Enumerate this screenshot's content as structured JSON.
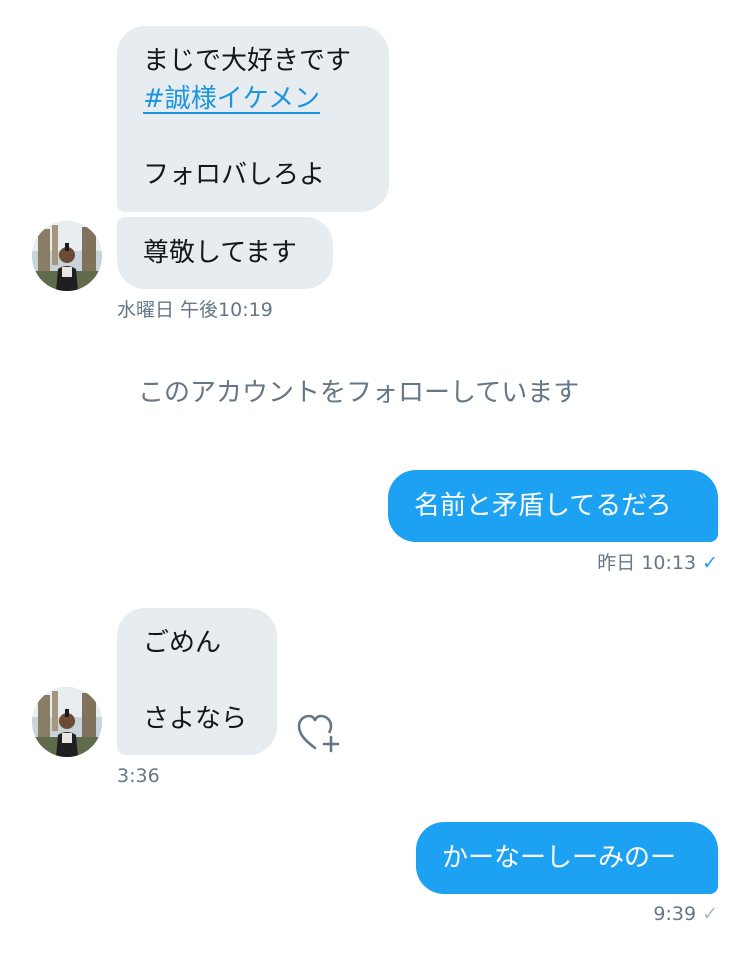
{
  "conversation": {
    "group1": {
      "bubble1": {
        "line1": "まじで大好きです",
        "hashtag": "#誠様イケメン",
        "line3": "フォロバしろよ"
      },
      "bubble2": "尊敬してます",
      "timestamp": "水曜日 午後10:19"
    },
    "system_notice": "このアカウントをフォローしています",
    "sent1": {
      "text": "名前と矛盾してるだろ",
      "timestamp": "昨日 10:13",
      "status_icon": "check-icon",
      "status_color": "#1da1f2"
    },
    "group2": {
      "line1": "ごめん",
      "line2": "さよなら",
      "timestamp": "3:36",
      "reaction_icon": "heart-plus-icon"
    },
    "sent2": {
      "text": "かーなーしーみのー",
      "timestamp": "9:39",
      "status_icon": "check-icon",
      "status_color": "#aab8c2"
    }
  },
  "colors": {
    "incoming_bubble": "#e6ecf0",
    "outgoing_bubble": "#1da1f2",
    "hashtag": "#1b95e0",
    "meta_text": "#657786"
  }
}
